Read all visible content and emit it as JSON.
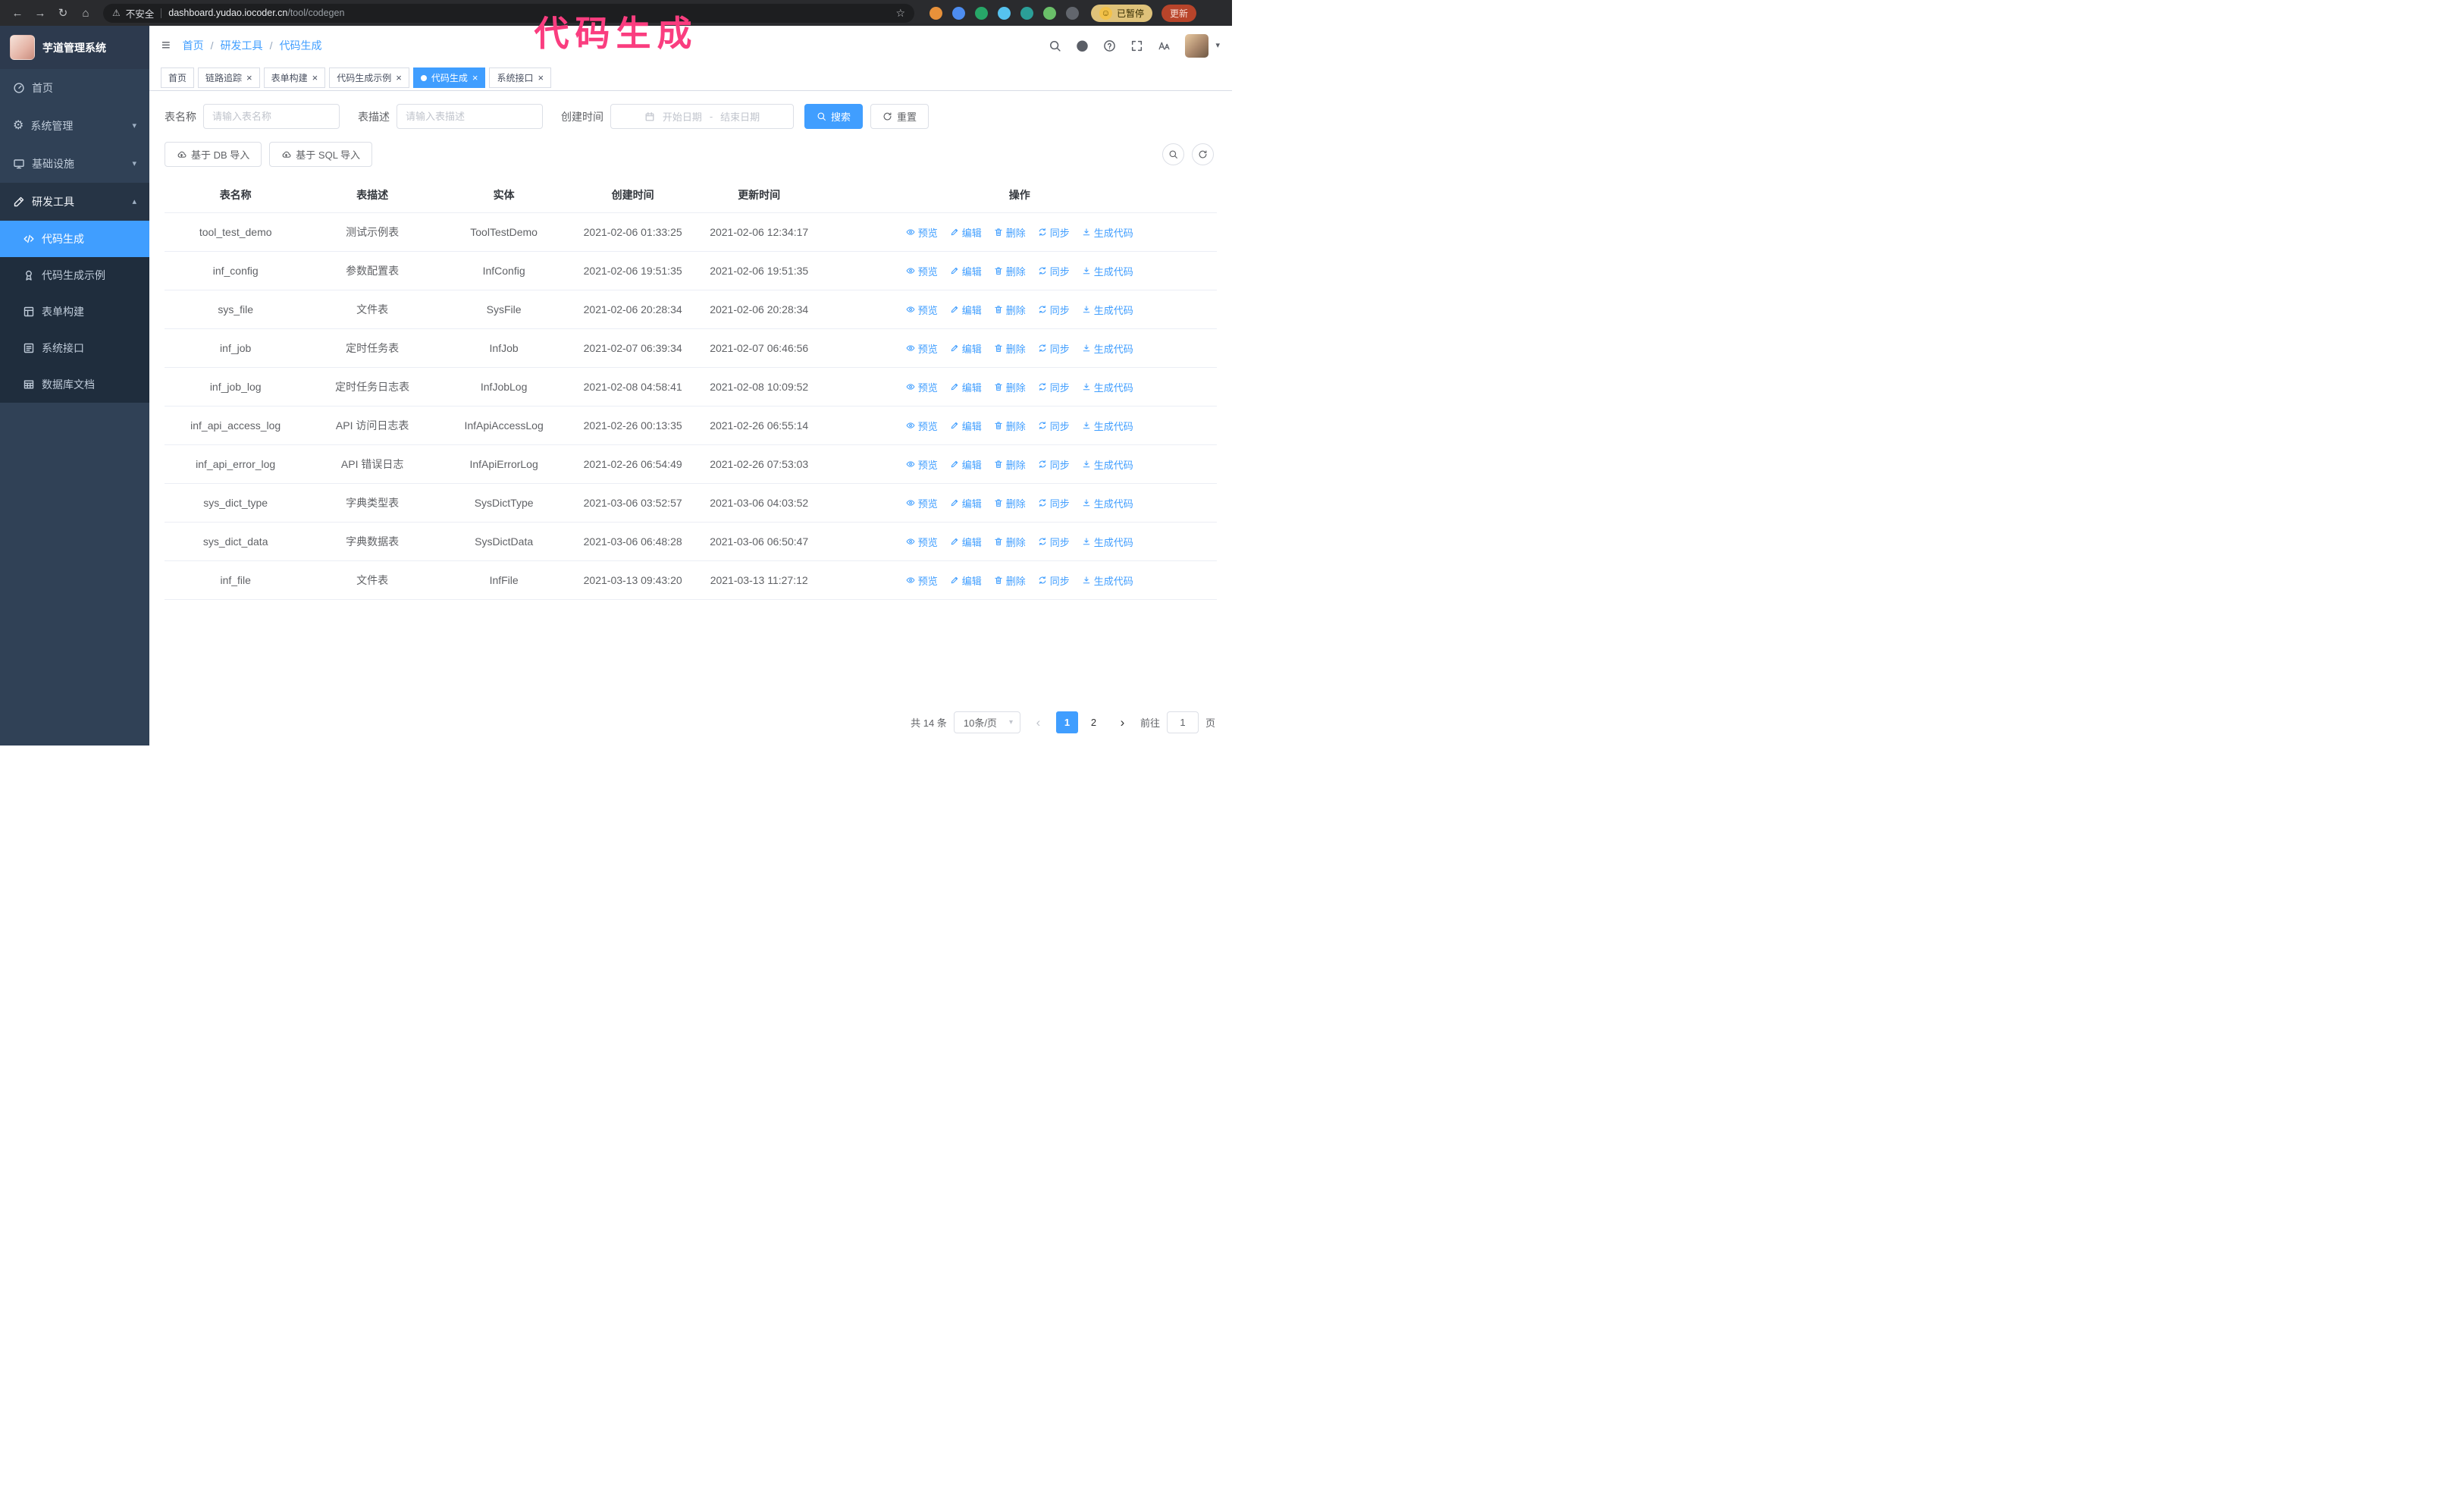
{
  "overlay": {
    "title": "代码生成",
    "color": "#fa3d7f"
  },
  "browser": {
    "security_label": "不安全",
    "url_host": "dashboard.yudao.iocoder.cn",
    "url_path": "/tool/codegen",
    "paused_badge": "已暂停",
    "update_label": "更新",
    "extensions": [
      "#e8913a",
      "#4d8df0",
      "#27a768",
      "#56c2ef",
      "#2b9f98",
      "#6abf69",
      "#62666d"
    ],
    "profile_color": "#f3c24a"
  },
  "icons": {
    "back-icon": "←",
    "forward-icon": "→",
    "reload-icon": "↻",
    "home-icon": "⌂",
    "warning-icon": "⚠",
    "star-icon": "☆",
    "hamburger-icon": "≡",
    "chevron-down-icon": "▾",
    "chevron-up-icon": "▴",
    "caret-down-icon": "▾",
    "close-icon": "×",
    "smiley-icon": "☺",
    "gear-icon": "⚙",
    "arrow-left-icon": "‹",
    "arrow-right-icon": "›"
  },
  "sidebar": {
    "logo_title": "芋道管理系统",
    "items": [
      {
        "key": "home",
        "label": "首页",
        "icon": "dashboard-icon"
      },
      {
        "key": "system",
        "label": "系统管理",
        "icon": "gear-icon",
        "chevron": "down"
      },
      {
        "key": "infra",
        "label": "基础设施",
        "icon": "monitor-icon",
        "chevron": "down"
      },
      {
        "key": "devtools",
        "label": "研发工具",
        "icon": "tools-icon",
        "chevron": "up",
        "open": true
      }
    ],
    "subitems": [
      {
        "key": "codegen",
        "label": "代码生成",
        "icon": "code-icon",
        "active": true
      },
      {
        "key": "codegen-example",
        "label": "代码生成示例",
        "icon": "medal-icon"
      },
      {
        "key": "form-builder",
        "label": "表单构建",
        "icon": "form-icon"
      },
      {
        "key": "api",
        "label": "系统接口",
        "icon": "api-icon"
      },
      {
        "key": "db-doc",
        "label": "数据库文档",
        "icon": "db-doc-icon"
      }
    ]
  },
  "header": {
    "breadcrumb": [
      "首页",
      "研发工具",
      "代码生成"
    ]
  },
  "tabs": [
    {
      "key": "home",
      "label": "首页",
      "closable": false
    },
    {
      "key": "tracer",
      "label": "链路追踪",
      "closable": true
    },
    {
      "key": "form-builder",
      "label": "表单构建",
      "closable": true
    },
    {
      "key": "codegen-example",
      "label": "代码生成示例",
      "closable": true
    },
    {
      "key": "codegen",
      "label": "代码生成",
      "closable": true,
      "active": true
    },
    {
      "key": "api",
      "label": "系统接口",
      "closable": true
    }
  ],
  "filters": {
    "name_label": "表名称",
    "name_placeholder": "请输入表名称",
    "desc_label": "表描述",
    "desc_placeholder": "请输入表描述",
    "time_label": "创建时间",
    "start_placeholder": "开始日期",
    "separator": "-",
    "end_placeholder": "结束日期",
    "search_label": "搜索",
    "reset_label": "重置"
  },
  "toolbar": {
    "import_db": "基于 DB 导入",
    "import_sql": "基于 SQL 导入"
  },
  "table": {
    "columns": [
      "表名称",
      "表描述",
      "实体",
      "创建时间",
      "更新时间",
      "操作"
    ],
    "actions": [
      {
        "key": "preview",
        "label": "预览",
        "icon": "eye-icon"
      },
      {
        "key": "edit",
        "label": "编辑",
        "icon": "edit-icon"
      },
      {
        "key": "delete",
        "label": "删除",
        "icon": "delete-icon"
      },
      {
        "key": "sync",
        "label": "同步",
        "icon": "sync-icon"
      },
      {
        "key": "generate-code",
        "label": "生成代码",
        "icon": "download-icon"
      }
    ],
    "rows": [
      {
        "name": "tool_test_demo",
        "desc": "测试示例表",
        "entity": "ToolTestDemo",
        "created": "2021-02-06 01:33:25",
        "updated": "2021-02-06 12:34:17"
      },
      {
        "name": "inf_config",
        "desc": "参数配置表",
        "entity": "InfConfig",
        "created": "2021-02-06 19:51:35",
        "updated": "2021-02-06 19:51:35"
      },
      {
        "name": "sys_file",
        "desc": "文件表",
        "entity": "SysFile",
        "created": "2021-02-06 20:28:34",
        "updated": "2021-02-06 20:28:34"
      },
      {
        "name": "inf_job",
        "desc": "定时任务表",
        "entity": "InfJob",
        "created": "2021-02-07 06:39:34",
        "updated": "2021-02-07 06:46:56"
      },
      {
        "name": "inf_job_log",
        "desc": "定时任务日志表",
        "entity": "InfJobLog",
        "created": "2021-02-08 04:58:41",
        "updated": "2021-02-08 10:09:52"
      },
      {
        "name": "inf_api_access_log",
        "desc": "API 访问日志表",
        "entity": "InfApiAccessLog",
        "created": "2021-02-26 00:13:35",
        "updated": "2021-02-26 06:55:14"
      },
      {
        "name": "inf_api_error_log",
        "desc": "API 错误日志",
        "entity": "InfApiErrorLog",
        "created": "2021-02-26 06:54:49",
        "updated": "2021-02-26 07:53:03"
      },
      {
        "name": "sys_dict_type",
        "desc": "字典类型表",
        "entity": "SysDictType",
        "created": "2021-03-06 03:52:57",
        "updated": "2021-03-06 04:03:52"
      },
      {
        "name": "sys_dict_data",
        "desc": "字典数据表",
        "entity": "SysDictData",
        "created": "2021-03-06 06:48:28",
        "updated": "2021-03-06 06:50:47"
      },
      {
        "name": "inf_file",
        "desc": "文件表",
        "entity": "InfFile",
        "created": "2021-03-13 09:43:20",
        "updated": "2021-03-13 11:27:12"
      }
    ]
  },
  "pagination": {
    "total": "共 14 条",
    "page_size": "10条/页",
    "pages": [
      "1",
      "2"
    ],
    "active_page": "1",
    "goto_label": "前往",
    "goto_value": "1",
    "unit_label": "页"
  }
}
